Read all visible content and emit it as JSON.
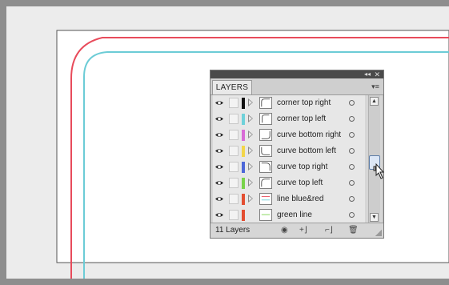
{
  "panel": {
    "title_tab": "LAYERS",
    "collapse_icon": "collapse-icon",
    "close_icon": "close-icon",
    "menu_icon": "panel-menu-icon",
    "layer_count_label": "11 Layers"
  },
  "layers": [
    {
      "label": "corner top right",
      "color": "#111111"
    },
    {
      "label": "corner top left",
      "color": "#6fd1da"
    },
    {
      "label": "curve bottom right",
      "color": "#d86bd6"
    },
    {
      "label": "curve bottom left",
      "color": "#f3d64a"
    },
    {
      "label": "curve top right",
      "color": "#4d67d8"
    },
    {
      "label": "curve top left",
      "color": "#79d34a"
    },
    {
      "label": "line blue&red",
      "color": "#e34e31"
    },
    {
      "label": "green line",
      "color": "#e34e31"
    }
  ],
  "footer_icons": [
    "make-clip-mask-icon",
    "create-sublayer-icon",
    "new-layer-icon",
    "delete-layer-icon"
  ],
  "colors": {
    "red_line": "#e84b5b",
    "cyan_line": "#6cccd6"
  }
}
